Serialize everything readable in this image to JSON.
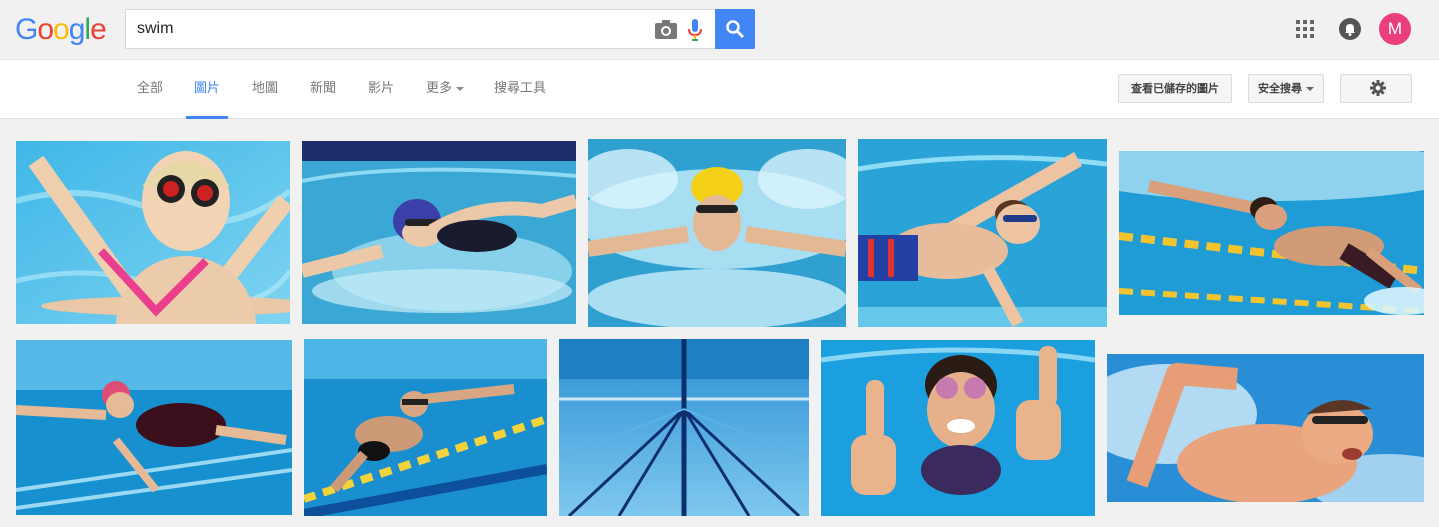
{
  "header": {
    "logo": [
      "G",
      "o",
      "o",
      "g",
      "l",
      "e"
    ],
    "logo_colors": [
      "#4285f4",
      "#ea4335",
      "#fbbc05",
      "#4285f4",
      "#34a853",
      "#ea4335"
    ],
    "search_value": "swim",
    "avatar_initial": "M"
  },
  "nav": {
    "tabs": [
      "全部",
      "圖片",
      "地圖",
      "新聞",
      "影片",
      "更多",
      "搜尋工具"
    ],
    "active_tab": "圖片",
    "saved_images_label": "查看已儲存的圖片",
    "safe_search_label": "安全搜尋"
  },
  "icons": {
    "camera": "camera-icon",
    "mic": "mic-icon",
    "search": "search-icon",
    "apps": "apps-grid-icon",
    "notifications": "bell-icon",
    "settings": "gear-icon"
  },
  "colors": {
    "accent": "#4285f4",
    "avatar": "#ea3f7c"
  },
  "results": [
    "girl-pink-swimsuit-goggles",
    "woman-freestyle-purple-cap",
    "butterfly-yellow-cap",
    "boy-underwater-red-trunks",
    "man-freestyle-lane-rope",
    "woman-freestyle-underwater",
    "man-underwater-lanes",
    "empty-pool-underwater-lanes",
    "girl-thumbs-up-underwater",
    "man-freestyle-breath"
  ]
}
